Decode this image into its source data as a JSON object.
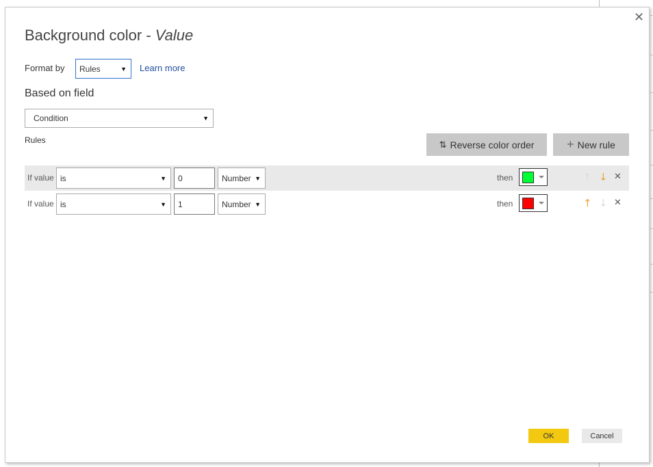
{
  "dialog": {
    "title_main": "Background color - ",
    "title_field": "Value",
    "format_by_label": "Format by",
    "format_by_value": "Rules",
    "learn_more": "Learn more",
    "based_on_field_label": "Based on field",
    "based_on_field_value": "Condition",
    "rules_label": "Rules",
    "reverse_color_order": "Reverse color order",
    "new_rule": "New rule",
    "ok": "OK",
    "cancel": "Cancel"
  },
  "rules": [
    {
      "if_label": "If value",
      "operator": "is",
      "value": "0",
      "type": "Number",
      "then_label": "then",
      "color": "#00ff33",
      "up_enabled": false,
      "down_enabled": true
    },
    {
      "if_label": "If value",
      "operator": "is",
      "value": "1",
      "type": "Number",
      "then_label": "then",
      "color": "#ff0000",
      "up_enabled": true,
      "down_enabled": false
    }
  ],
  "colors": {
    "accent": "#f2c811",
    "arrow": "#e8a33d",
    "link": "#1f4e9c"
  }
}
